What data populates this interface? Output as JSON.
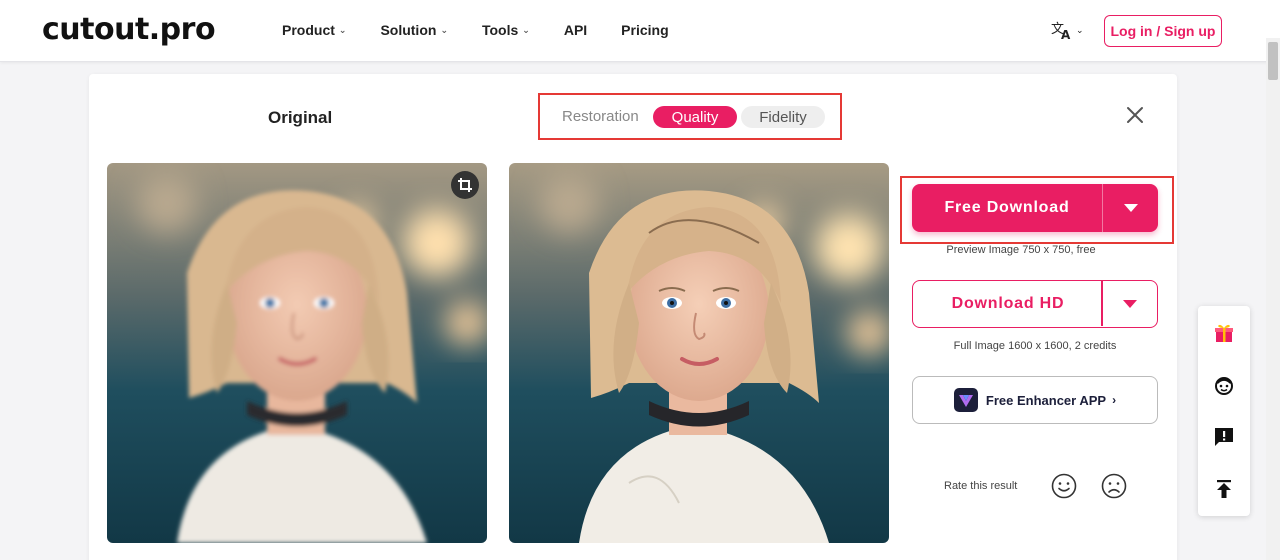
{
  "header": {
    "logo": "cutout.pro",
    "nav": [
      {
        "label": "Product",
        "dropdown": true
      },
      {
        "label": "Solution",
        "dropdown": true
      },
      {
        "label": "Tools",
        "dropdown": true
      },
      {
        "label": "API",
        "dropdown": false
      },
      {
        "label": "Pricing",
        "dropdown": false
      }
    ],
    "language_icon": "translate-icon",
    "login_label": "Log in / Sign up"
  },
  "editor": {
    "original_label": "Original",
    "mode_label": "Restoration",
    "modes": [
      {
        "label": "Quality",
        "active": true
      },
      {
        "label": "Fidelity",
        "active": false
      }
    ],
    "free_download_label": "Free Download",
    "free_download_note": "Preview Image 750 x 750, free",
    "download_hd_label": "Download HD",
    "download_hd_note": "Full Image 1600 x 1600, 2 credits",
    "app_label": "Free Enhancer APP",
    "rate_label": "Rate this result"
  },
  "sidebar": {
    "icons": [
      "gift-icon",
      "support-agent-icon",
      "feedback-icon",
      "back-to-top-icon"
    ]
  },
  "colors": {
    "brand_pink": "#e91e63",
    "highlight_red": "#e53935",
    "app_navy": "#1c1f3a"
  }
}
